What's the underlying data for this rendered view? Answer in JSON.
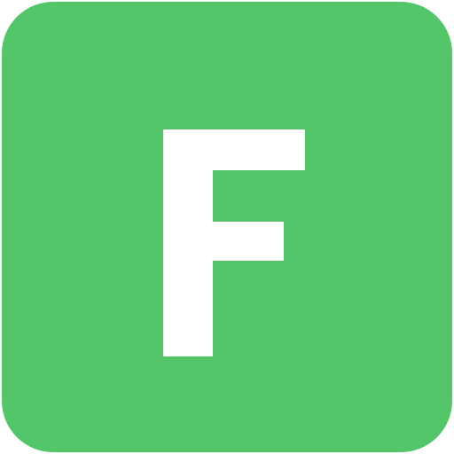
{
  "icon": {
    "name": "letter-f-app-icon",
    "letter": "F",
    "background_color": "#54c66a",
    "glyph_color": "#ffffff"
  }
}
